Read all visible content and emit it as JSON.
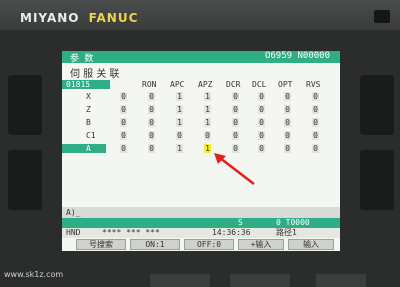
{
  "brand": {
    "maker": "MIYANO",
    "control": "FANUC"
  },
  "screen": {
    "title": "参 数",
    "program_number": "O6959 N00000",
    "subtitle": "伺 服 关 联",
    "param_number": "01815",
    "columns": [
      "RON",
      "APC",
      "APZ",
      "DCR",
      "DCL",
      "OPT",
      "RVS"
    ],
    "rows": [
      {
        "axis": "X",
        "bits": [
          "0",
          "0",
          "1",
          "1",
          "0",
          "0",
          "0",
          "0"
        ]
      },
      {
        "axis": "Z",
        "bits": [
          "0",
          "0",
          "1",
          "1",
          "0",
          "0",
          "0",
          "0"
        ]
      },
      {
        "axis": "B",
        "bits": [
          "0",
          "0",
          "1",
          "1",
          "0",
          "0",
          "0",
          "0"
        ]
      },
      {
        "axis": "C1",
        "bits": [
          "0",
          "0",
          "0",
          "0",
          "0",
          "0",
          "0",
          "0"
        ]
      },
      {
        "axis": "A",
        "bits": [
          "0",
          "0",
          "1",
          "1",
          "0",
          "0",
          "0",
          "0"
        ]
      }
    ],
    "input_prompt": "A)_",
    "spindle_label": "S",
    "spindle_value": "0 T0000",
    "mode": "HND",
    "status_stars": "**** *** ***",
    "time": "14:36:36",
    "path": "路径1",
    "softkeys": [
      "号搜索",
      "ON:1",
      "OFF:0",
      "+输入",
      "输入"
    ]
  },
  "watermark": "www.sk1z.com",
  "colors": {
    "accent": "#2fae86",
    "cursor": "#f2ec3a",
    "arrow": "#e02020"
  }
}
